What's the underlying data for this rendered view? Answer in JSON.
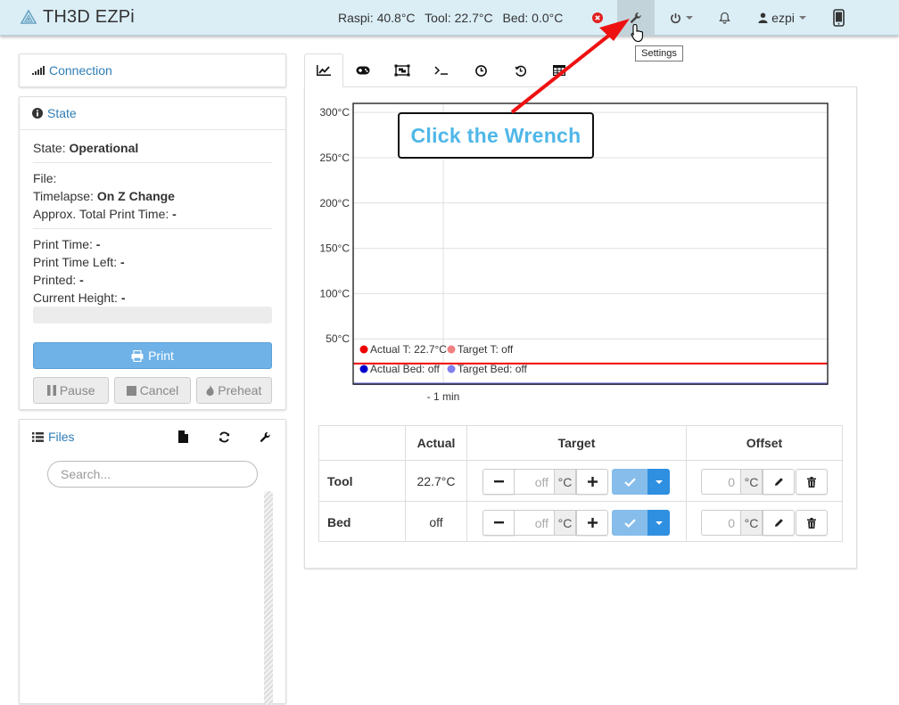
{
  "app": {
    "brand": "TH3D EZPi"
  },
  "navbar": {
    "raspi_temp": "Raspi: 40.8°C",
    "tool_temp": "Tool: 22.7°C",
    "bed_temp": "Bed: 0.0°C",
    "user": "ezpi",
    "settings_tooltip": "Settings",
    "icons": [
      "error-icon",
      "wrench-icon",
      "power-icon",
      "bell-icon",
      "user-icon",
      "mobile-icon"
    ]
  },
  "sidebar": {
    "connection": {
      "title": "Connection"
    },
    "state": {
      "title": "State",
      "state_label": "State:",
      "state_value": "Operational",
      "file_label": "File:",
      "file_value": "",
      "timelapse_label": "Timelapse:",
      "timelapse_value": "On Z Change",
      "approx_label": "Approx. Total Print Time:",
      "approx_value": "-",
      "print_time_label": "Print Time:",
      "print_time_value": "-",
      "time_left_label": "Print Time Left:",
      "time_left_value": "-",
      "printed_label": "Printed:",
      "printed_value": "-",
      "height_label": "Current Height:",
      "height_value": "-",
      "progress": 0,
      "print_button": "Print",
      "pause_button": "Pause",
      "cancel_button": "Cancel",
      "preheat_button": "Preheat"
    },
    "files": {
      "title": "Files",
      "search_placeholder": "Search..."
    }
  },
  "tabs": [
    "temperature-tab",
    "control-tab",
    "gcode-viewer-tab",
    "terminal-tab",
    "timelapse-tab",
    "history-tab",
    "table-tab"
  ],
  "chart_data": {
    "type": "line",
    "ylim": [
      0,
      310
    ],
    "y_ticks": [
      "300°C",
      "250°C",
      "200°C",
      "150°C",
      "100°C",
      "50°C"
    ],
    "y_tick_values": [
      300,
      250,
      200,
      150,
      100,
      50
    ],
    "x_tick": "- 1 min",
    "series": [
      {
        "name": "Actual T: 22.7°C",
        "color": "#ee0000",
        "values": [
          22.7,
          22.7
        ]
      },
      {
        "name": "Target T: off",
        "color": "#f08080",
        "values": [
          0,
          0
        ]
      },
      {
        "name": "Actual Bed: off",
        "color": "#0000cc",
        "values": [
          0,
          0
        ]
      },
      {
        "name": "Target Bed: off",
        "color": "#8080ee",
        "values": [
          0,
          0
        ]
      }
    ]
  },
  "temperature_table": {
    "headers": [
      "",
      "Actual",
      "Target",
      "Offset"
    ],
    "rows": [
      {
        "name": "Tool",
        "actual": "22.7°C",
        "target": "off",
        "target_unit": "°C",
        "offset": "0",
        "offset_unit": "°C"
      },
      {
        "name": "Bed",
        "actual": "off",
        "target": "off",
        "target_unit": "°C",
        "offset": "0",
        "offset_unit": "°C"
      }
    ]
  },
  "annotation": {
    "text": "Click the Wrench",
    "color": "#4fb7e8",
    "arrow_color": "#ee1111"
  }
}
